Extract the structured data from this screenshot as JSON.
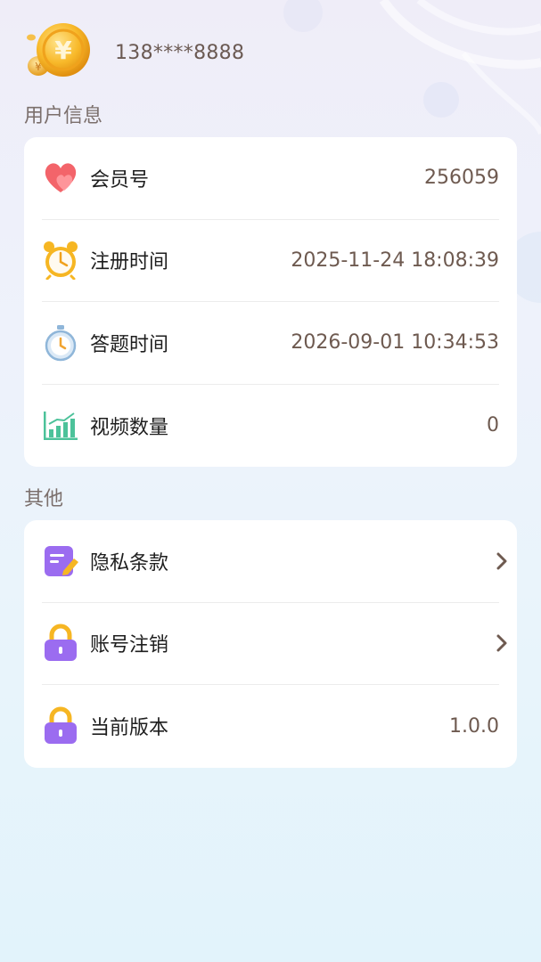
{
  "user": {
    "phone": "138****8888",
    "avatar_icon": "gold-coin-icon"
  },
  "sections": {
    "user_info_title": "用户信息",
    "other_title": "其他"
  },
  "user_info": [
    {
      "icon": "heart-icon",
      "label": "会员号",
      "value": "256059"
    },
    {
      "icon": "alarm-clock-icon",
      "label": "注册时间",
      "value": "2025-11-24 18:08:39"
    },
    {
      "icon": "stopwatch-icon",
      "label": "答题时间",
      "value": "2026-09-01 10:34:53"
    },
    {
      "icon": "bar-chart-icon",
      "label": "视频数量",
      "value": "0"
    }
  ],
  "other": [
    {
      "icon": "document-edit-icon",
      "label": "隐私条款"
    },
    {
      "icon": "lock-icon",
      "label": "账号注销"
    },
    {
      "icon": "lock-icon",
      "label": "当前版本",
      "value": "1.0.0"
    }
  ],
  "colors": {
    "accent_purple": "#9b6cf0",
    "value_brown": "#6e5a50",
    "heart_red": "#f3646a",
    "chart_green": "#4cc29a"
  }
}
